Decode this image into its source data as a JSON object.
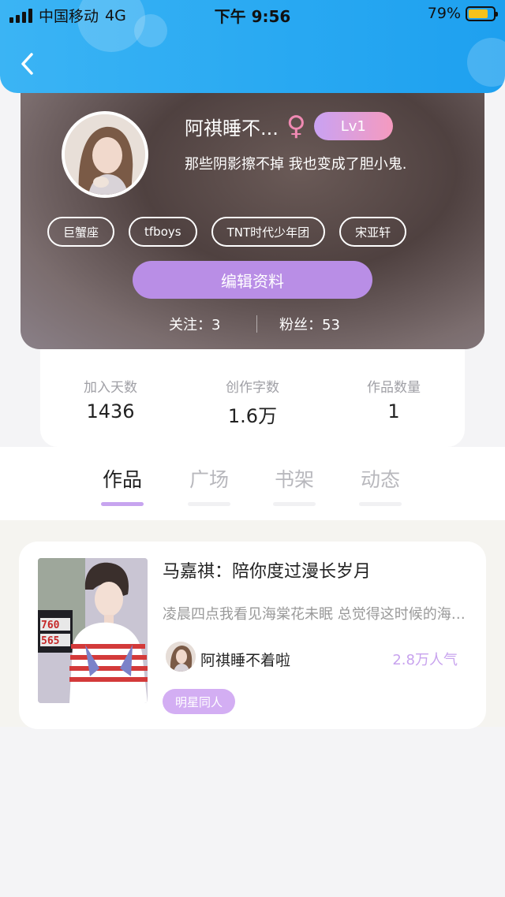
{
  "status_bar": {
    "carrier": "中国移动",
    "network": "4G",
    "time": "下午 9:56",
    "battery_percent": "79%",
    "battery_level": 0.79
  },
  "header": {
    "back_icon": "chevron-left-icon"
  },
  "profile": {
    "name": "阿祺睡不...",
    "gender_symbol": "♀",
    "level": "Lv1",
    "bio": "那些阴影擦不掉 我也变成了胆小鬼.",
    "tags": [
      "巨蟹座",
      "tfboys",
      "TNT时代少年团",
      "宋亚轩"
    ],
    "edit_label": "编辑资料",
    "following": "关注：3",
    "fans": "粉丝：53"
  },
  "stats": [
    {
      "label": "加入天数",
      "value": "1436"
    },
    {
      "label": "创作字数",
      "value": "1.6万"
    },
    {
      "label": "作品数量",
      "value": "1"
    }
  ],
  "tabs": [
    "作品",
    "广场",
    "书架",
    "动态"
  ],
  "active_tab": 0,
  "works": [
    {
      "title": "马嘉祺：陪你度过漫长岁月",
      "description": "凌晨四点我看见海棠花未眠 总觉得这时候的海棠花",
      "author": "阿祺睡不着啦",
      "popularity": "2.8万人气",
      "genre": "明星同人",
      "cover_numbers": [
        "760",
        "565"
      ]
    }
  ],
  "colors": {
    "header_blue": "#29a9f2",
    "accent_purple": "#b98ee6",
    "tab_underline": "#c7a4ef",
    "popularity": "#c8a3ee"
  }
}
